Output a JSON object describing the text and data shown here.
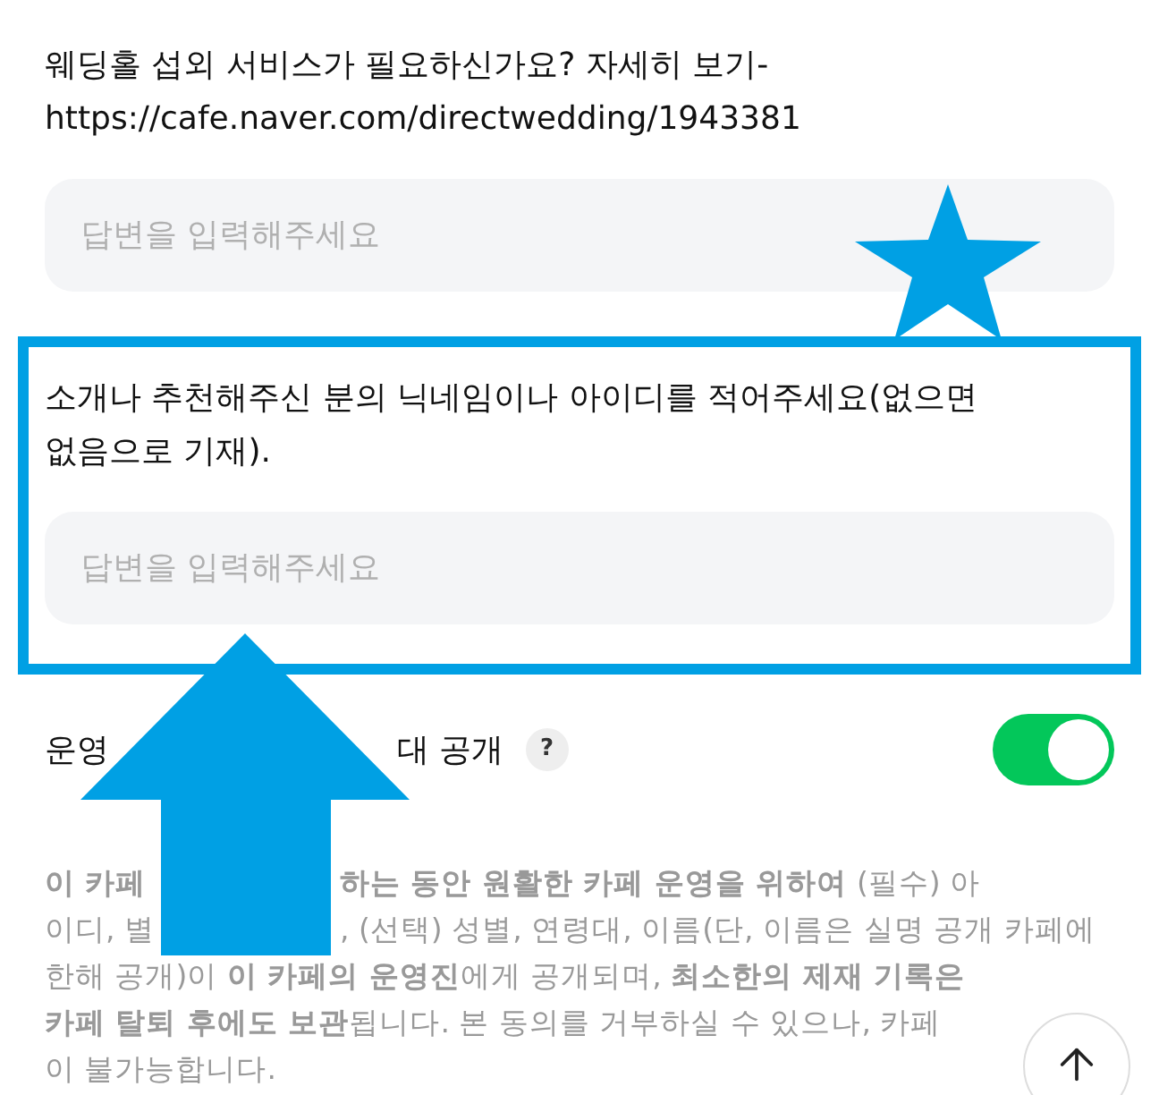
{
  "questions": [
    {
      "label": "웨딩홀 섭외 서비스가 필요하신가요? 자세히 보기-https://cafe.naver.com/directwedding/1943381",
      "placeholder": "답변을 입력해주세요",
      "highlighted": false
    },
    {
      "label": "소개나 추천해주신 분의 닉네임이나 아이디를 적어주세요(없으면 없음으로 기재).",
      "placeholder": "답변을 입력해주세요",
      "highlighted": true
    }
  ],
  "disclosure": {
    "label_parts": [
      "운영",
      "대 공개"
    ],
    "help": "?",
    "on": true
  },
  "notice_lines": [
    {
      "parts": [
        "**이 카페**",
        "**하는 동안 원활한 카페 운영을 위하여** (필수) 아"
      ]
    },
    {
      "parts": [
        "이디, 별",
        ", (선택) 성별, 연령대, 이름(단, 이름은 실명 공개 카페에"
      ]
    },
    {
      "parts": [
        "한해 공개)이 **이 카페의 운영진**에게 공개되며, **최소한의 제재 기록은**"
      ]
    },
    {
      "parts": [
        "**카페 탈퇴 후에도 보관**됩니다. 본 동의를 거부하실 수 있으나, 카페"
      ]
    },
    {
      "parts": [
        "이 불가능합니다."
      ]
    }
  ],
  "annotations": [
    {
      "kind": "star"
    },
    {
      "kind": "arrow"
    }
  ]
}
